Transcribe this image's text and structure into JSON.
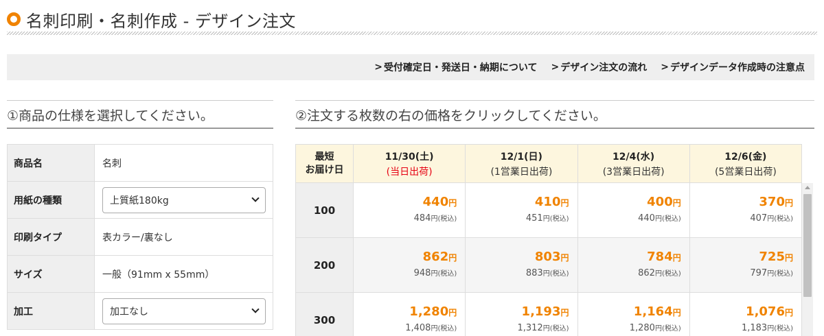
{
  "page_title": "名刺印刷・名刺作成 - デザイン注文",
  "nav_links": [
    "受付確定日・発送日・納期について",
    "デザイン注文の流れ",
    "デザインデータ作成時の注意点"
  ],
  "nav_arrow": ">",
  "section1_heading": "①商品の仕様を選択してください。",
  "section2_heading": "②注文する枚数の右の価格をクリックしてください。",
  "spec": {
    "product_label": "商品名",
    "product_value": "名刺",
    "paper_label": "用紙の種類",
    "paper_selected": "上質紙180kg",
    "print_label": "印刷タイプ",
    "print_value": "表カラー/裏なし",
    "size_label": "サイズ",
    "size_value": "一般（91mm x 55mm）",
    "finish_label": "加工",
    "finish_selected": "加工なし"
  },
  "price_table": {
    "qty_header_line1": "最短",
    "qty_header_line2": "お届け日",
    "columns": [
      {
        "date": "11/30(土)",
        "sub": "(当日出荷)"
      },
      {
        "date": "12/1(日)",
        "sub": "(1営業日出荷)"
      },
      {
        "date": "12/4(水)",
        "sub": "(3営業日出荷)"
      },
      {
        "date": "12/6(金)",
        "sub": "(5営業日出荷)"
      }
    ],
    "yen_unit": "円",
    "tax_label": "(税込)",
    "rows": [
      {
        "qty": "100",
        "prices": [
          "440",
          "410",
          "400",
          "370"
        ],
        "tax": [
          "484",
          "451",
          "440",
          "407"
        ]
      },
      {
        "qty": "200",
        "prices": [
          "862",
          "803",
          "784",
          "725"
        ],
        "tax": [
          "948",
          "883",
          "862",
          "797"
        ]
      },
      {
        "qty": "300",
        "prices": [
          "1,280",
          "1,193",
          "1,164",
          "1,076"
        ],
        "tax": [
          "1,408",
          "1,312",
          "1,280",
          "1,183"
        ]
      }
    ]
  },
  "colors": {
    "accent_orange": "#f08300",
    "same_day_red": "#e60012",
    "header_cream": "#fdf6de"
  }
}
